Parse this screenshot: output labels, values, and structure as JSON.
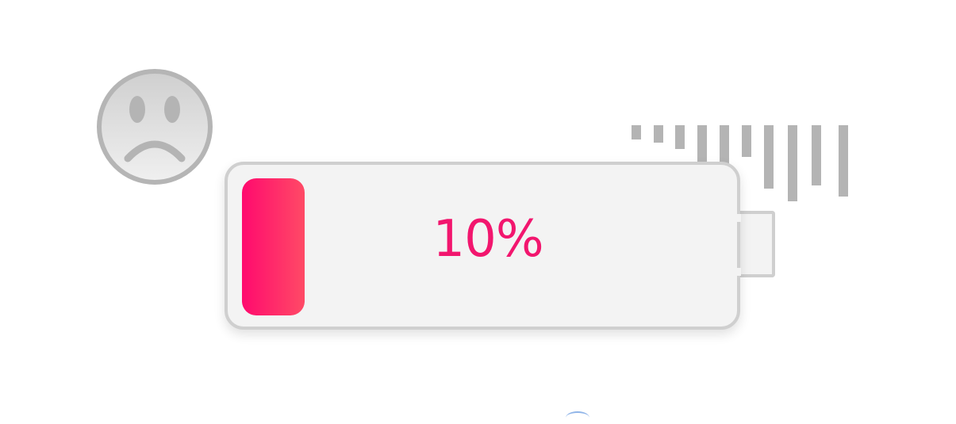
{
  "battery": {
    "level": 0.1,
    "percent_label": "10%",
    "fill_color_start": "#ff0a6e",
    "fill_color_end": "#ff4a66",
    "text_color": "#f2166e",
    "body_color": "#f3f3f3",
    "border_color": "#cfcfcf"
  },
  "icons": {
    "mood": "sad-face-icon",
    "signal": "signal-bars-icon"
  },
  "colors": {
    "icon_gray": "#b4b4b4"
  }
}
